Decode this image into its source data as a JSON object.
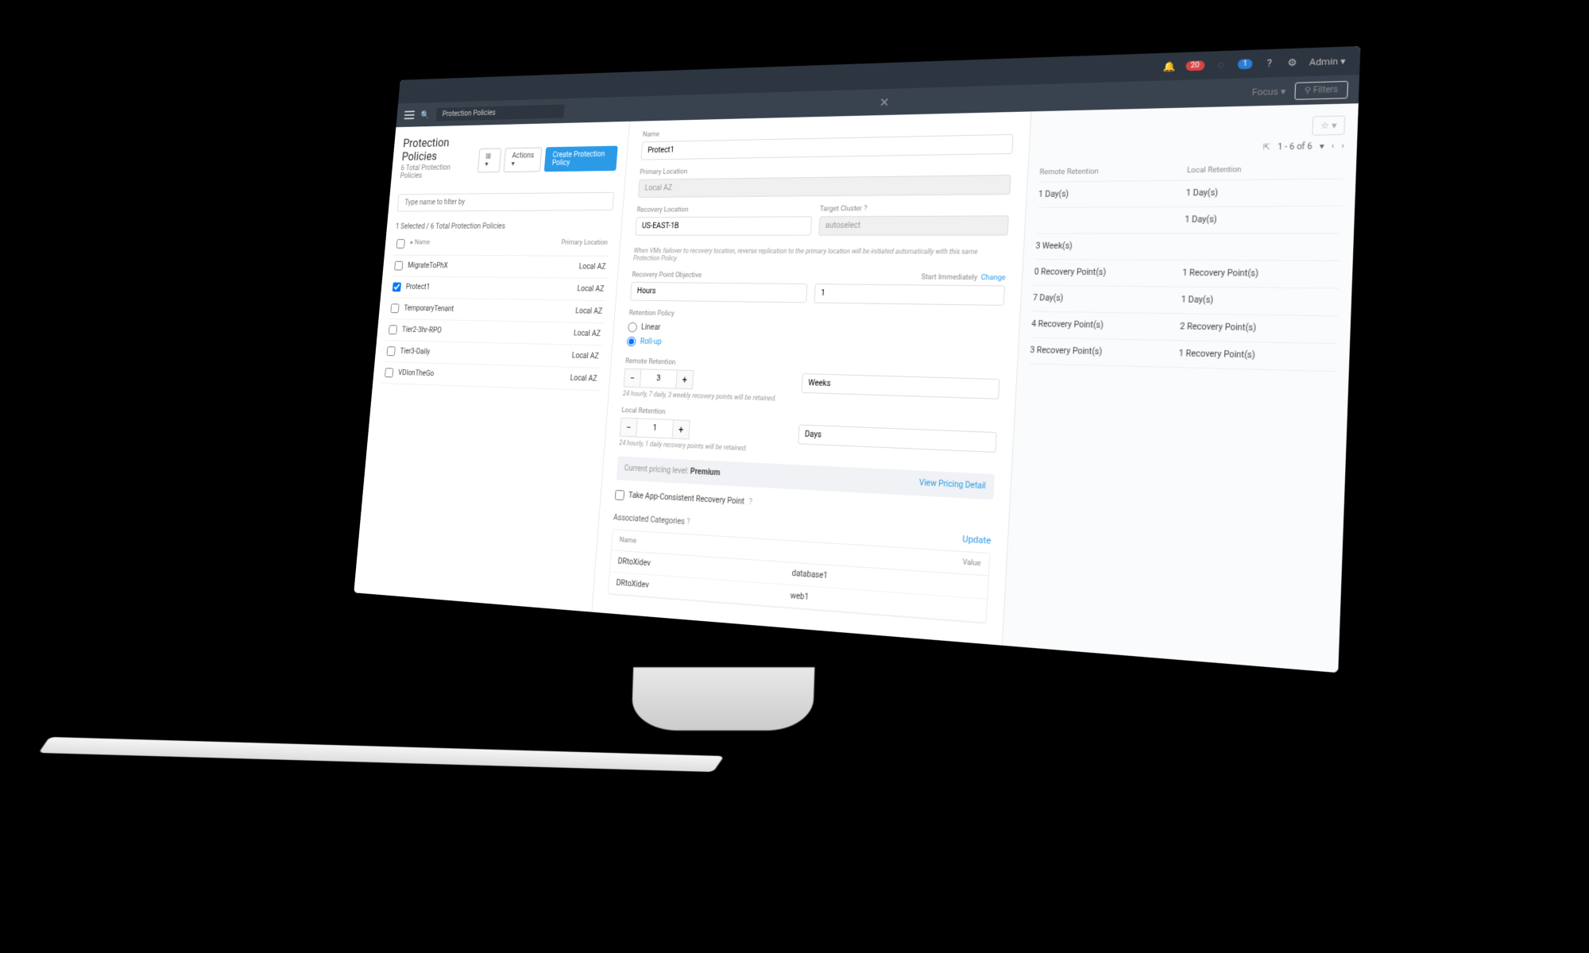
{
  "topbar": {
    "alert_count": "20",
    "info_count": "1",
    "user_label": "Admin"
  },
  "secondbar": {
    "breadcrumb": "Protection Policies",
    "focus_label": "Focus",
    "filters_label": "Filters"
  },
  "left": {
    "title": "Protection Policies",
    "subtitle": "6 Total Protection Policies",
    "actions_label": "Actions",
    "create_label": "Create Protection Policy",
    "filter_placeholder": "Type name to filter by",
    "selected_label": "1 Selected  /  6 Total Protection Policies",
    "col_name": "Name",
    "col_location": "Primary Location",
    "rows": [
      {
        "name": "MigrateToPhX",
        "loc": "Local AZ",
        "checked": false
      },
      {
        "name": "Protect1",
        "loc": "Local AZ",
        "checked": true
      },
      {
        "name": "TemporaryTenant",
        "loc": "Local AZ",
        "checked": false
      },
      {
        "name": "Tier2-3hr-RPO",
        "loc": "Local AZ",
        "checked": false
      },
      {
        "name": "Tier3-Daily",
        "loc": "Local AZ",
        "checked": false
      },
      {
        "name": "VDIonTheGo",
        "loc": "Local AZ",
        "checked": false
      }
    ]
  },
  "form": {
    "name_label": "Name",
    "name_value": "Protect1",
    "primary_loc_label": "Primary Location",
    "primary_loc_value": "Local AZ",
    "recovery_loc_label": "Recovery Location",
    "recovery_loc_value": "US-EAST-1B",
    "target_cluster_label": "Target Cluster",
    "target_cluster_value": "autoselect",
    "failover_helper": "When VMs failover to recovery location, reverse replication to the primary location will be initiated automatically with this same Protection Policy.",
    "rpo_label": "Recovery Point Objective",
    "rpo_unit": "Hours",
    "rpo_value": "1",
    "start_label": "Start Immediately",
    "change_label": "Change",
    "retention_label": "Retention Policy",
    "retention_linear": "Linear",
    "retention_rollup": "Roll-up",
    "remote_ret_label": "Remote Retention",
    "remote_ret_value": "3",
    "remote_ret_unit": "Weeks",
    "remote_ret_helper": "24 hourly, 7 daily, 3 weekly recovery points will be retained.",
    "local_ret_label": "Local Retention",
    "local_ret_value": "1",
    "local_ret_unit": "Days",
    "local_ret_helper": "24 hourly, 1 daily recovery points will be retained.",
    "pricing_prefix": "Current pricing level: ",
    "pricing_level": "Premium",
    "pricing_link": "View Pricing Detail",
    "app_consistent_label": "Take App-Consistent Recovery Point",
    "assoc_label": "Associated Categories",
    "update_label": "Update",
    "assoc_col_name": "Name",
    "assoc_col_value": "Value",
    "assoc_rows": [
      {
        "name": "DRtoXidev",
        "value": "database1"
      },
      {
        "name": "DRtoXidev",
        "value": "web1"
      }
    ]
  },
  "right": {
    "pager_text": "1 - 6 of 6",
    "col_remote": "Remote Retention",
    "col_local": "Local Retention",
    "rows": [
      {
        "remote": "1 Day(s)",
        "local": "1 Day(s)"
      },
      {
        "remote": "",
        "local": "1 Day(s)"
      },
      {
        "remote": "3 Week(s)",
        "local": ""
      },
      {
        "remote": "0 Recovery Point(s)",
        "local": "1 Recovery Point(s)"
      },
      {
        "remote": "7 Day(s)",
        "local": "1 Day(s)"
      },
      {
        "remote": "4 Recovery Point(s)",
        "local": "2 Recovery Point(s)"
      },
      {
        "remote": "3 Recovery Point(s)",
        "local": "1 Recovery Point(s)"
      }
    ]
  }
}
